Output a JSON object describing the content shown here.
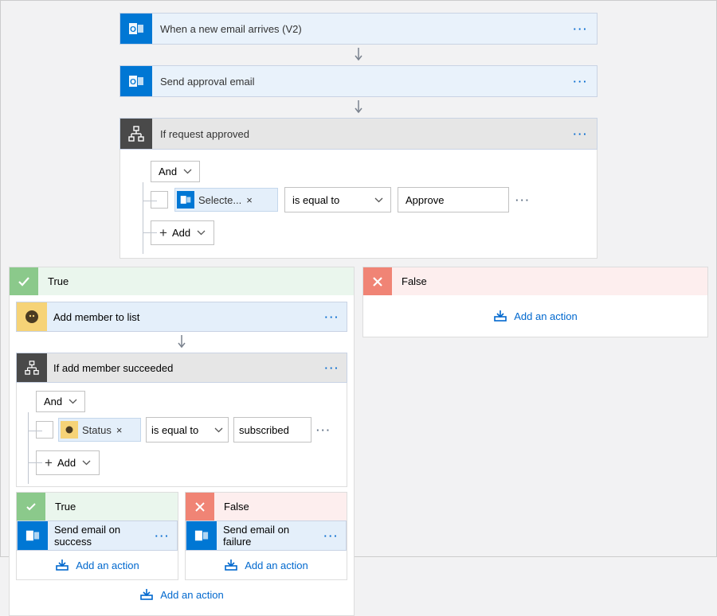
{
  "trigger1": {
    "label": "When a new email arrives (V2)"
  },
  "trigger2": {
    "label": "Send approval email"
  },
  "condition1": {
    "title": "If request approved",
    "logic": "And",
    "token": "Selecte...",
    "op": "is equal to",
    "value": "Approve",
    "add": "Add"
  },
  "trueBranch": {
    "label": "True",
    "action1": {
      "label": "Add member to list"
    },
    "condition2": {
      "title": "If add member succeeded",
      "logic": "And",
      "token": "Status",
      "op": "is equal to",
      "value": "subscribed",
      "add": "Add"
    },
    "inner": {
      "true": {
        "label": "True",
        "action": "Send email on success",
        "add": "Add an action"
      },
      "false": {
        "label": "False",
        "action": "Send email on failure",
        "add": "Add an action"
      }
    },
    "addOuter": "Add an action"
  },
  "falseBranch": {
    "label": "False",
    "add": "Add an action"
  }
}
